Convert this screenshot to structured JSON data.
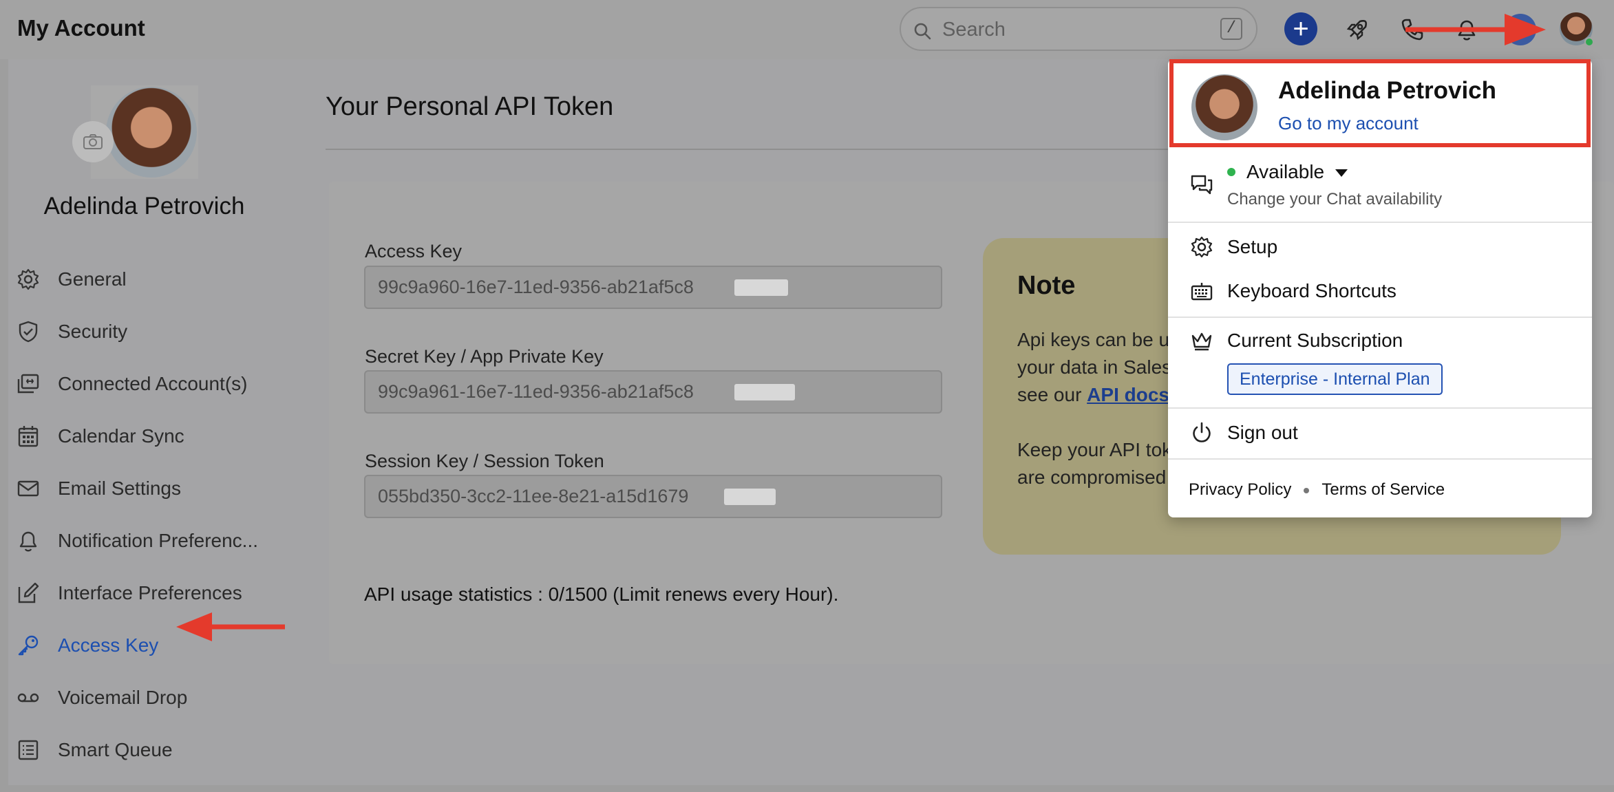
{
  "app": {
    "title": "My Account"
  },
  "search": {
    "placeholder": "Search",
    "shortcut_key": "/"
  },
  "header_icons": [
    "plus-icon",
    "rocket-icon",
    "phone-icon",
    "bell-icon",
    "avatar"
  ],
  "profile": {
    "name": "Adelinda Petrovich"
  },
  "sidebar": {
    "items": [
      {
        "label": "General",
        "icon": "gear-icon"
      },
      {
        "label": "Security",
        "icon": "shield-icon"
      },
      {
        "label": "Connected Account(s)",
        "icon": "connected-accounts-icon"
      },
      {
        "label": "Calendar Sync",
        "icon": "calendar-icon"
      },
      {
        "label": "Email Settings",
        "icon": "envelope-icon"
      },
      {
        "label": "Notification Preferenc...",
        "icon": "bell-icon"
      },
      {
        "label": "Interface Preferences",
        "icon": "pencil-square-icon"
      },
      {
        "label": "Access Key",
        "icon": "key-icon",
        "active": true
      },
      {
        "label": "Voicemail Drop",
        "icon": "voicemail-icon"
      },
      {
        "label": "Smart Queue",
        "icon": "checklist-icon"
      }
    ]
  },
  "main": {
    "title": "Your Personal API Token",
    "fields": [
      {
        "label": "Access Key",
        "value": "99c9a960-16e7-11ed-9356-ab21af5c8"
      },
      {
        "label": "Secret Key / App Private Key",
        "value": "99c9a961-16e7-11ed-9356-ab21af5c8"
      },
      {
        "label": "Session Key / Session Token",
        "value": "055bd350-3cc2-11ee-8e21-a15d1679"
      }
    ],
    "usage": "API usage statistics : 0/1500 (Limit renews every Hour).",
    "note": {
      "title": "Note",
      "line1": "Api keys can be u",
      "line2": "your data in Sales",
      "line3_prefix": "see our ",
      "line3_link": "API docs",
      "line4": "Keep your API tok",
      "line5": "are compromised"
    }
  },
  "dropdown": {
    "name": "Adelinda Petrovich",
    "account_link": "Go to my account",
    "availability": "Available",
    "availability_sub": "Change your Chat availability",
    "setup": "Setup",
    "shortcuts": "Keyboard Shortcuts",
    "subscription": "Current Subscription",
    "plan": "Enterprise - Internal Plan",
    "sign_out": "Sign out",
    "privacy": "Privacy Policy",
    "terms": "Terms of Service"
  },
  "colors": {
    "accent": "#1c4fb0",
    "annotation_red": "#e43a2c",
    "note_bg": "#fdf6c3",
    "status_green": "#2fb34f"
  }
}
